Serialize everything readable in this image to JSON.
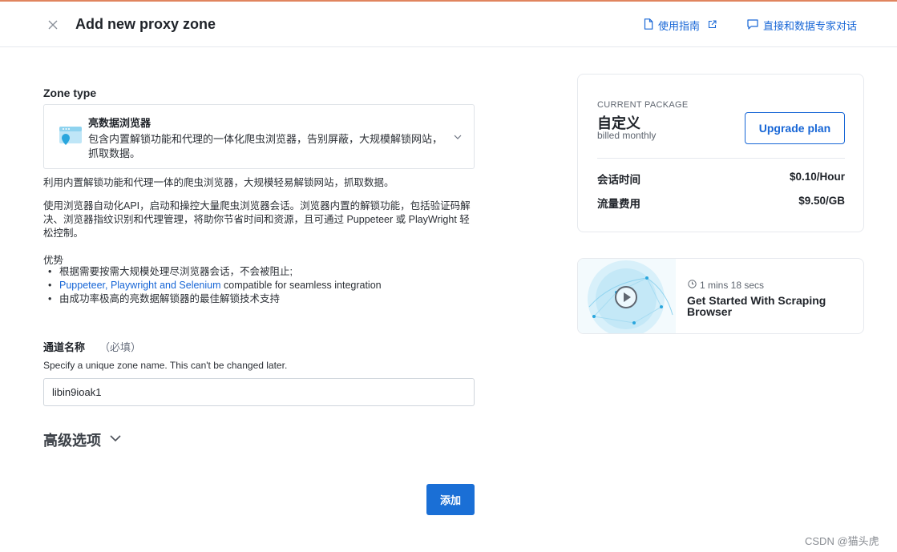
{
  "header": {
    "title": "Add new proxy zone",
    "guide_label": "使用指南",
    "expert_label": "直接和数据专家对话"
  },
  "zone_type": {
    "label": "Zone type",
    "selected_name": "亮数据浏览器",
    "selected_desc": "包含内置解锁功能和代理的一体化爬虫浏览器，告别屏蔽，大规模解锁网站，抓取数据。"
  },
  "description": {
    "intro": "利用内置解锁功能和代理一体的爬虫浏览器，大规模轻易解锁网站，抓取数据。",
    "detail": "使用浏览器自动化API，启动和操控大量爬虫浏览器会话。浏览器内置的解锁功能，包括验证码解决、浏览器指纹识别和代理管理，将助你节省时间和资源，且可通过 Puppeteer 或 PlayWright 轻松控制。",
    "advantages_title": "优势",
    "adv1": "根据需要按需大规模处理尽浏览器会话，不会被阻止;",
    "adv2_link": "Puppeteer, Playwright and Selenium",
    "adv2_rest": " compatible for seamless integration",
    "adv3": "由成功率极高的亮数据解锁器的最佳解锁技术支持"
  },
  "channel": {
    "label": "通道名称",
    "required": "（必填）",
    "hint": "Specify a unique zone name. This can't be changed later.",
    "value": "libin9ioak1"
  },
  "advanced": {
    "label": "高级选项"
  },
  "submit_label": "添加",
  "package": {
    "label": "CURRENT PACKAGE",
    "name": "自定义",
    "billing": "billed monthly",
    "upgrade_label": "Upgrade plan",
    "rows": [
      {
        "label": "会话时间",
        "value": "$0.10/Hour"
      },
      {
        "label": "流量费用",
        "value": "$9.50/GB"
      }
    ]
  },
  "video": {
    "duration": "1 mins 18 secs",
    "title": "Get Started With Scraping Browser"
  },
  "watermark": "CSDN @猫头虎",
  "colors": {
    "accent": "#1766d6",
    "primary_button": "#1a6fd6",
    "top_strip": "#e0845e"
  }
}
